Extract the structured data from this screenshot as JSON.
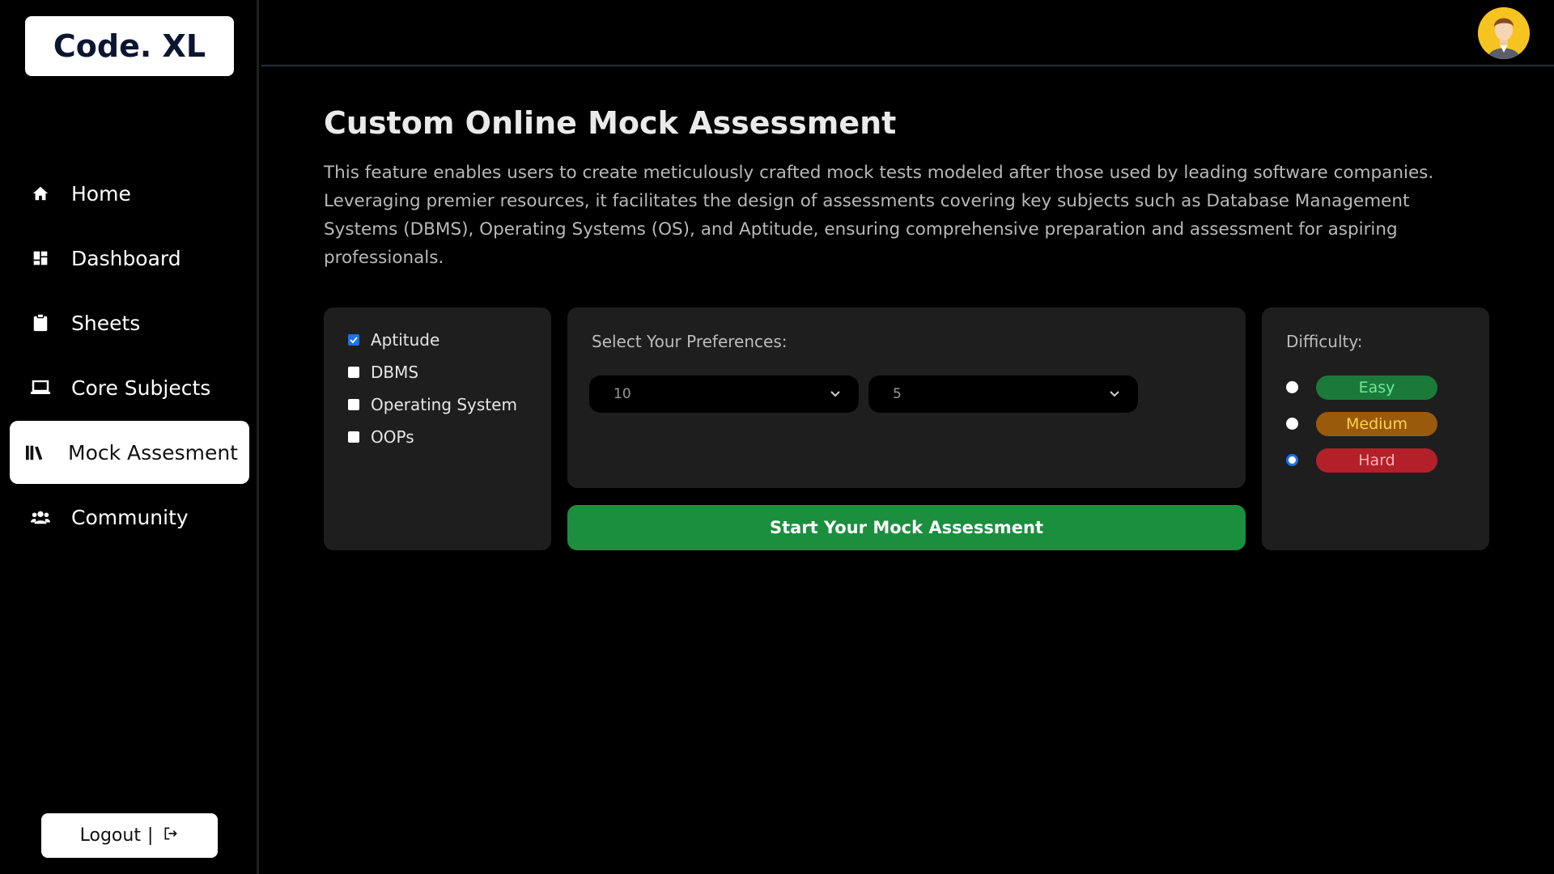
{
  "brand": {
    "logo_text": "Code. XL"
  },
  "sidebar": {
    "items": [
      {
        "label": "Home",
        "icon": "home-icon",
        "active": false
      },
      {
        "label": "Dashboard",
        "icon": "dashboard-icon",
        "active": false
      },
      {
        "label": "Sheets",
        "icon": "clipboard-icon",
        "active": false
      },
      {
        "label": "Core Subjects",
        "icon": "laptop-icon",
        "active": false
      },
      {
        "label": "Mock Assesment",
        "icon": "books-icon",
        "active": true
      },
      {
        "label": "Community",
        "icon": "users-icon",
        "active": false
      }
    ],
    "logout_label": "Logout",
    "logout_separator": "|"
  },
  "header": {
    "avatar_icon": "user-avatar-icon"
  },
  "main": {
    "title": "Custom Online Mock Assessment",
    "description": "This feature enables users to create meticulously crafted mock tests modeled after those used by leading software companies. Leveraging premier resources, it facilitates the design of assessments covering key subjects such as Database Management Systems (DBMS), Operating Systems (OS), and Aptitude, ensuring comprehensive preparation and assessment for aspiring professionals."
  },
  "subjects": [
    {
      "label": "Aptitude",
      "checked": true
    },
    {
      "label": "DBMS",
      "checked": false
    },
    {
      "label": "Operating System",
      "checked": false
    },
    {
      "label": "OOPs",
      "checked": false
    }
  ],
  "preferences": {
    "label": "Select Your Preferences:",
    "select_1_value": "10",
    "select_2_value": "5"
  },
  "start_button_label": "Start Your Mock Assessment",
  "difficulty": {
    "label": "Difficulty:",
    "options": [
      {
        "label": "Easy",
        "checked": false,
        "bg": "#1b7a3a",
        "fg": "#6fe89a"
      },
      {
        "label": "Medium",
        "checked": false,
        "bg": "#9a5a0c",
        "fg": "#ffd24a"
      },
      {
        "label": "Hard",
        "checked": true,
        "bg": "#b3202a",
        "fg": "#ffb3b8"
      }
    ]
  },
  "colors": {
    "accent_green": "#1b8f3e",
    "checkbox_blue": "#1a73e8",
    "panel_bg": "#1e1e1e"
  }
}
